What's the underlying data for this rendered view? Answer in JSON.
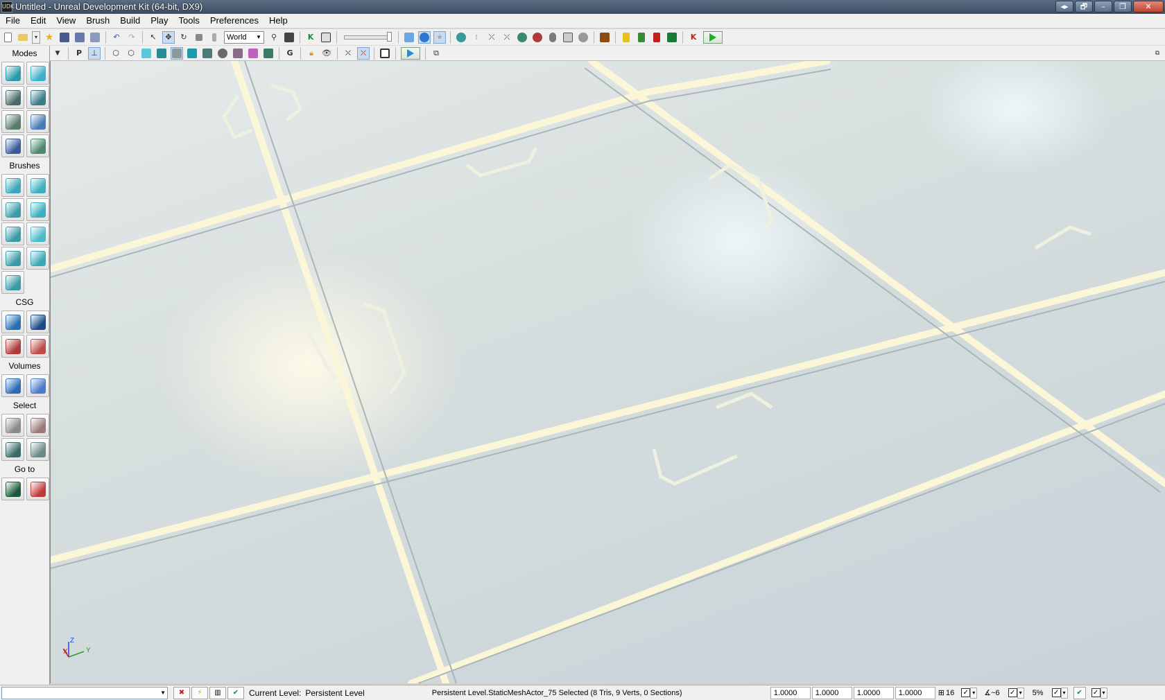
{
  "window": {
    "title": "Untitled - Unreal Development Kit (64-bit, DX9)",
    "app_icon": "UDK",
    "buttons": [
      "◂▸",
      "🗗",
      "–",
      "❐",
      "✕"
    ]
  },
  "menu": [
    "File",
    "Edit",
    "View",
    "Brush",
    "Build",
    "Play",
    "Tools",
    "Preferences",
    "Help"
  ],
  "toolbar": {
    "coordinate_system": "World"
  },
  "sidebar": {
    "sections": [
      {
        "title": "Modes",
        "buttons": [
          {
            "name": "camera-mode-icon",
            "color": "#2a9aa8"
          },
          {
            "name": "geometry-mode-icon",
            "color": "#3bb0c8"
          },
          {
            "name": "terrain-mode-icon",
            "color": "#4a6a6a"
          },
          {
            "name": "texture-align-icon",
            "color": "#3a7a8a"
          },
          {
            "name": "mesh-paint-icon",
            "color": "#5a7a6a"
          },
          {
            "name": "static-mesh-mode-icon",
            "color": "#4a7ab8"
          },
          {
            "name": "landscape-mode-icon",
            "color": "#3a5a9a"
          },
          {
            "name": "foliage-mode-icon",
            "color": "#4a8a6a"
          }
        ]
      },
      {
        "title": "Brushes",
        "buttons": [
          {
            "name": "cube-brush-icon",
            "color": "#3aa8b8"
          },
          {
            "name": "cone-brush-icon",
            "color": "#3ab0c0"
          },
          {
            "name": "curved-stair-brush-icon",
            "color": "#3a9aa8"
          },
          {
            "name": "cylinder-brush-icon",
            "color": "#3ab0c0"
          },
          {
            "name": "linear-stair-brush-icon",
            "color": "#3a9aa8"
          },
          {
            "name": "sheet-brush-icon",
            "color": "#4abac8"
          },
          {
            "name": "spiral-stair-brush-icon",
            "color": "#3a9aa8"
          },
          {
            "name": "sphere-brush-icon",
            "color": "#3aa8b8"
          },
          {
            "name": "volumetric-brush-icon",
            "color": "#3a9aa8"
          }
        ]
      },
      {
        "title": "CSG",
        "buttons": [
          {
            "name": "csg-add-icon",
            "color": "#2a70b0"
          },
          {
            "name": "csg-subtract-icon",
            "color": "#1a4a8a"
          },
          {
            "name": "csg-intersect-icon",
            "color": "#b03a3a"
          },
          {
            "name": "csg-deintersect-icon",
            "color": "#c04a4a"
          }
        ]
      },
      {
        "title": "Volumes",
        "buttons": [
          {
            "name": "add-volume-icon",
            "color": "#2a6ab8"
          },
          {
            "name": "volume-list-icon",
            "color": "#4a7ac8"
          }
        ]
      },
      {
        "title": "Select",
        "buttons": [
          {
            "name": "show-selected-icon",
            "color": "#8a8a8a"
          },
          {
            "name": "hide-selected-icon",
            "color": "#9a7a7a"
          },
          {
            "name": "select-inside-icon",
            "color": "#3a6a6a"
          },
          {
            "name": "invert-selection-icon",
            "color": "#6a8a8a"
          }
        ]
      },
      {
        "title": "Go to",
        "buttons": [
          {
            "name": "goto-actor-icon",
            "color": "#1a5a3a"
          },
          {
            "name": "goto-builder-brush-icon",
            "color": "#c03a3a"
          }
        ]
      }
    ]
  },
  "viewport": {
    "axis_labels": {
      "x": "X",
      "z": "Z",
      "y": "Y"
    }
  },
  "statusbar": {
    "current_level_label": "Current Level:",
    "current_level_value": "Persistent Level",
    "selection_info": "Persistent Level.StaticMeshActor_75 Selected (8 Tris, 9 Verts, 0 Sections)",
    "drag_grid_values": [
      "1.0000",
      "1.0000",
      "1.0000",
      "1.0000"
    ],
    "grid_size": "16",
    "rotation_snap": "6",
    "scale_snap": "5%"
  }
}
